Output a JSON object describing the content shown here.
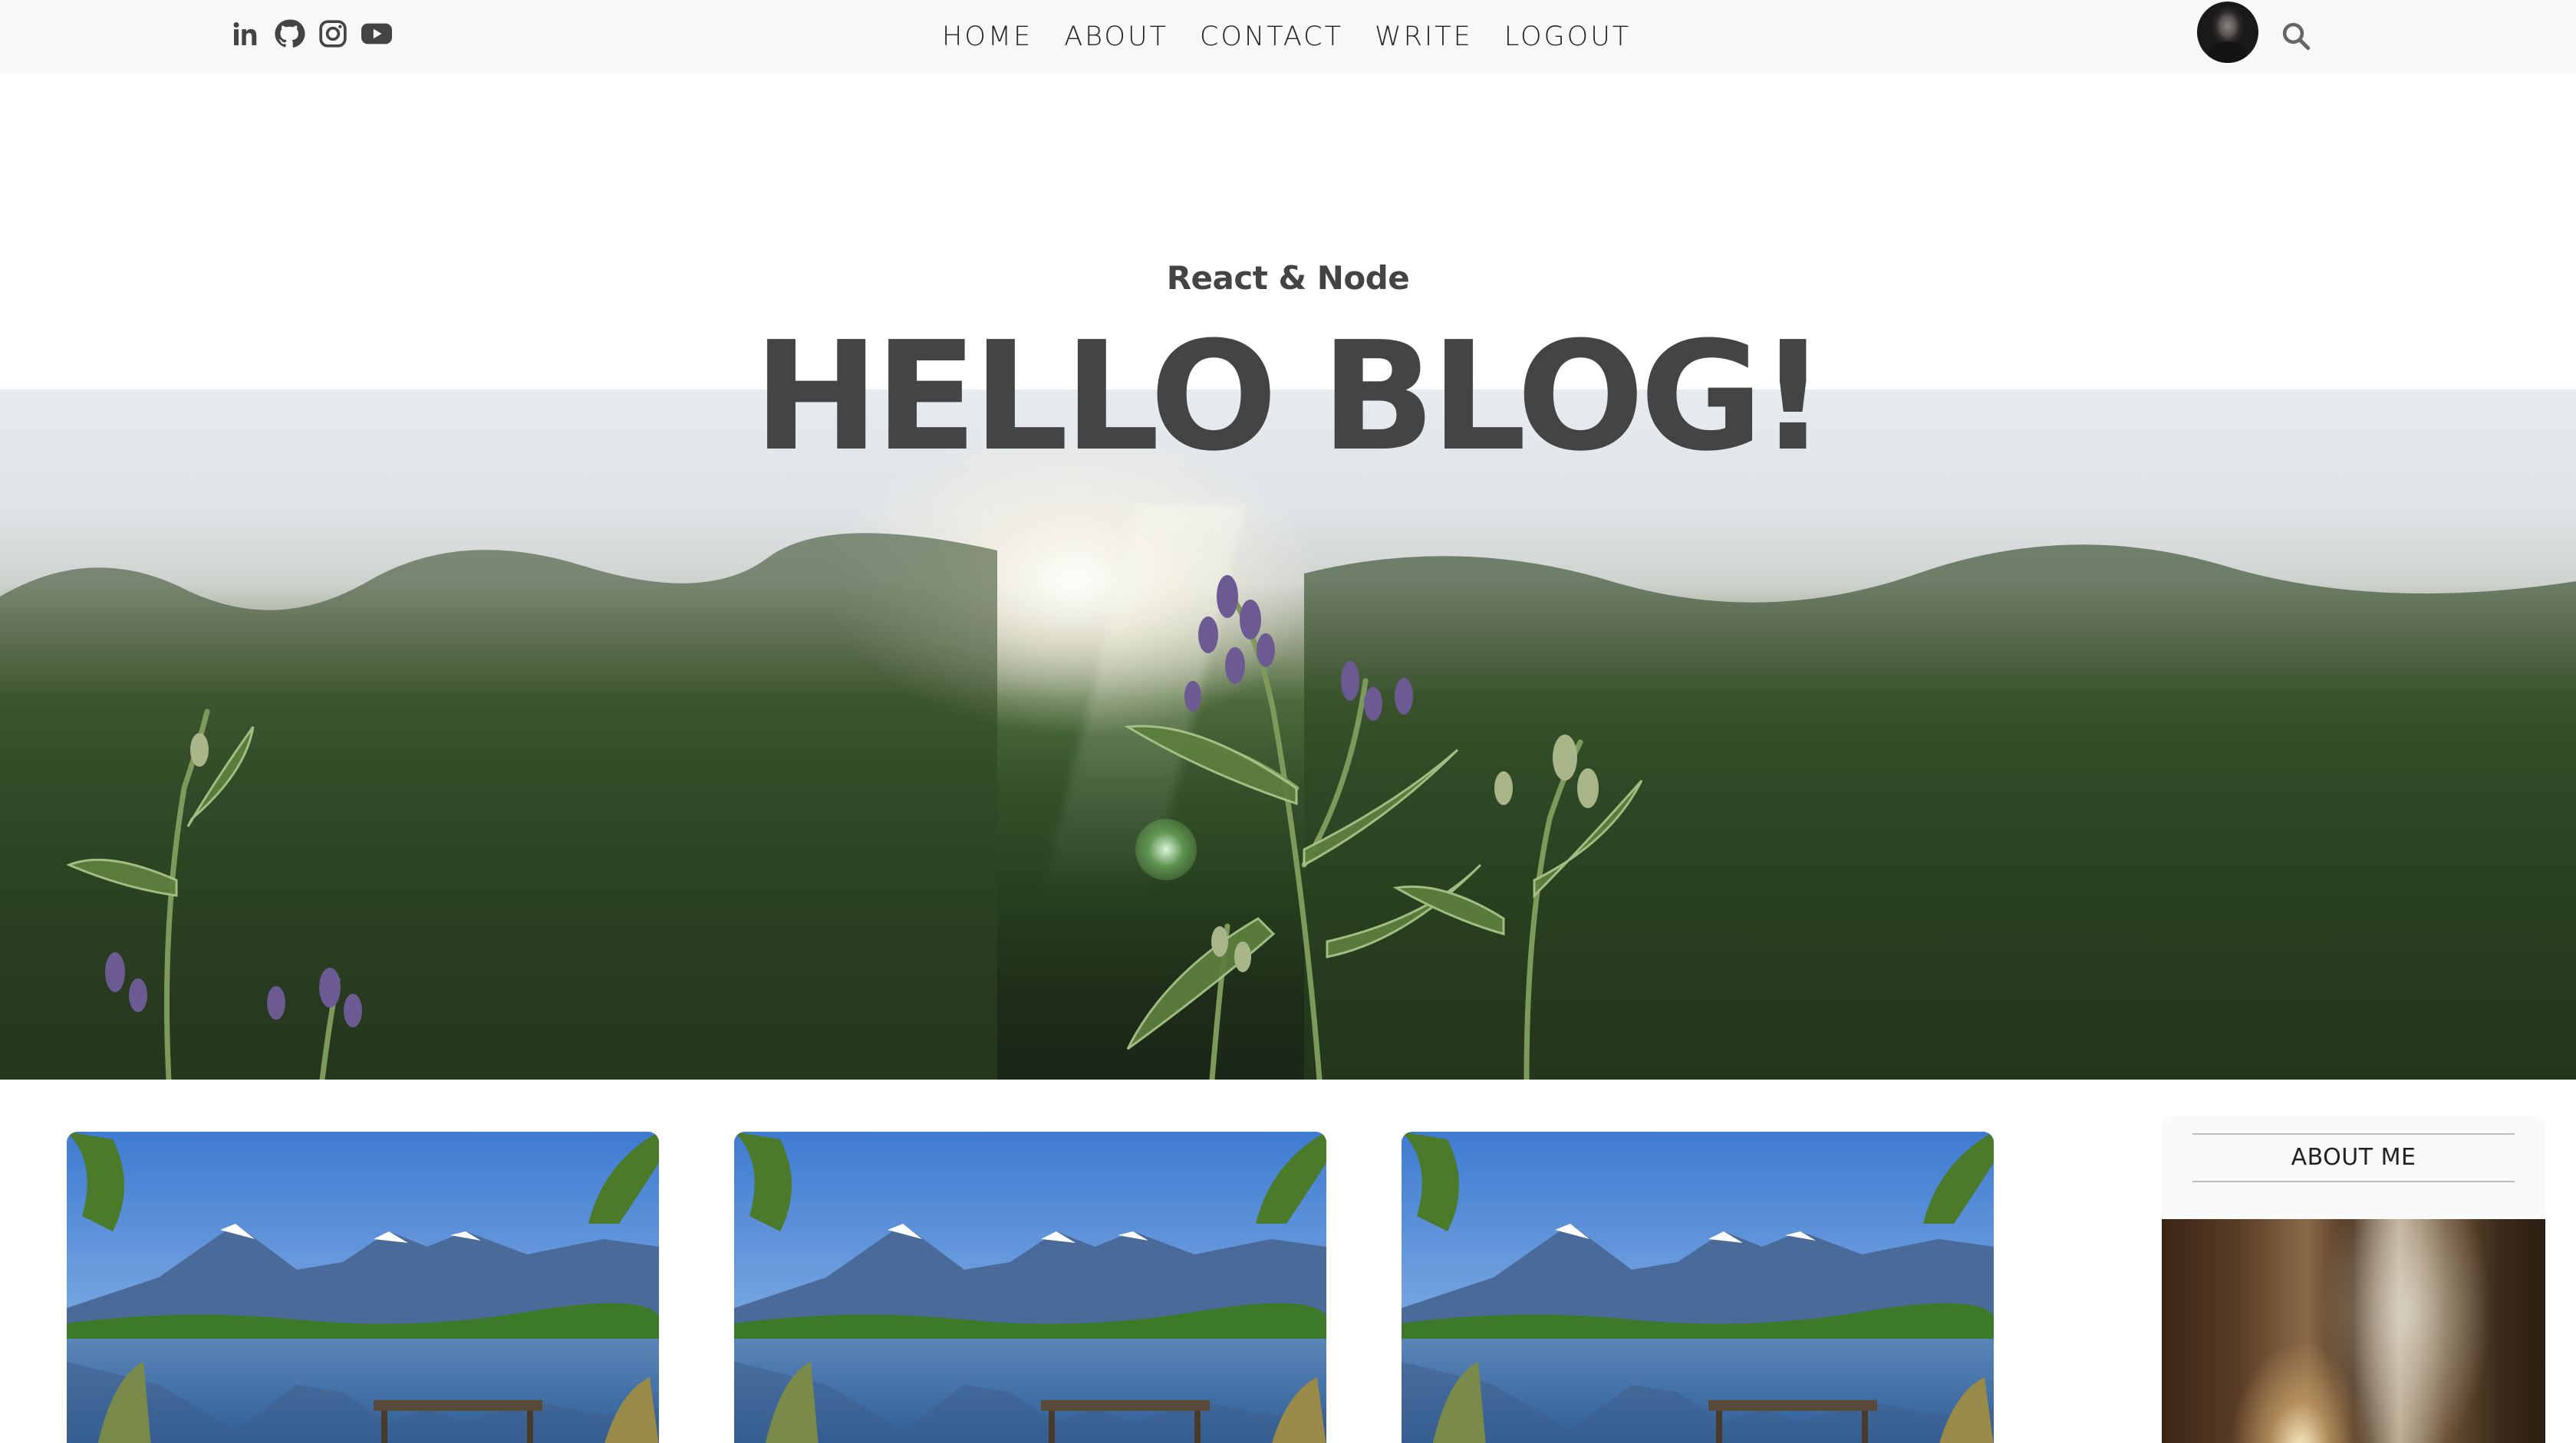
{
  "topbar": {
    "socials": [
      {
        "icon": "linkedin-icon"
      },
      {
        "icon": "github-icon"
      },
      {
        "icon": "instagram-icon"
      },
      {
        "icon": "youtube-icon"
      }
    ],
    "nav": [
      "HOME",
      "ABOUT",
      "CONTACT",
      "WRITE",
      "LOGOUT"
    ],
    "avatar_icon": "avatar",
    "search_icon": "search-icon"
  },
  "header": {
    "subtitle": "React & Node",
    "title": "HELLO BLOG!"
  },
  "hero": {
    "image": "hero-flowers-sunset"
  },
  "posts": [
    {
      "image": "lake-bench-mountains"
    },
    {
      "image": "lake-bench-mountains"
    },
    {
      "image": "lake-bench-mountains"
    }
  ],
  "sidebar": {
    "title": "ABOUT ME",
    "image": "forest-sunlight"
  },
  "colors": {
    "topbar_bg": "#f8f8f8",
    "text_dark": "#444444",
    "nav_text": "#222222",
    "sidebar_bg": "#fafafa"
  }
}
